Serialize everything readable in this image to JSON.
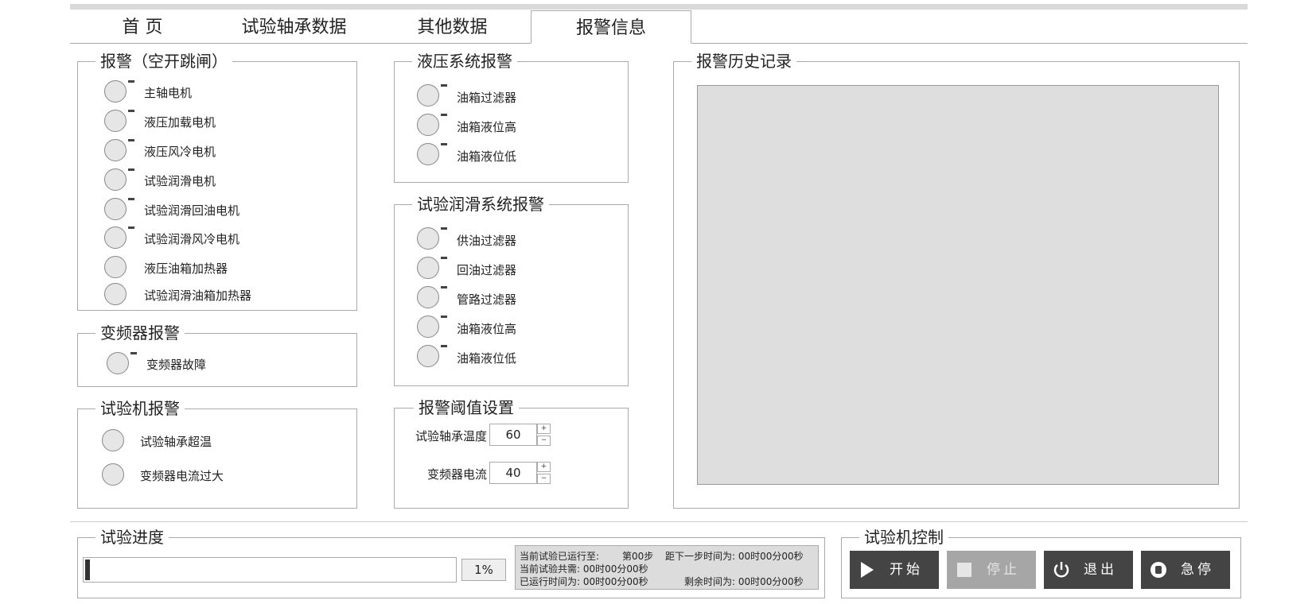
{
  "tabs": [
    "首  页",
    "试验轴承数据",
    "其他数据",
    "报警信息"
  ],
  "groups": {
    "breaker": {
      "title": "报警（空开跳闸）",
      "items": [
        "主轴电机",
        "液压加载电机",
        "液压风冷电机",
        "试验润滑电机",
        "试验润滑回油电机",
        "试验润滑风冷电机",
        "液压油箱加热器",
        "试验润滑油箱加热器"
      ]
    },
    "inverter": {
      "title": "变频器报警",
      "items": [
        "变频器故障"
      ]
    },
    "tester": {
      "title": "试验机报警",
      "items": [
        "试验轴承超温",
        "变频器电流过大"
      ]
    },
    "hydraulic": {
      "title": "液压系统报警",
      "items": [
        "油箱过滤器",
        "油箱液位高",
        "油箱液位低"
      ]
    },
    "lube": {
      "title": "试验润滑系统报警",
      "items": [
        "供油过滤器",
        "回油过滤器",
        "管路过滤器",
        "油箱液位高",
        "油箱液位低"
      ]
    },
    "threshold": {
      "title": "报警阈值设置",
      "bearing_temp_label": "试验轴承温度",
      "bearing_temp_value": "60",
      "inverter_current_label": "变频器电流",
      "inverter_current_value": "40",
      "plus": "+",
      "minus": "−"
    },
    "history": {
      "title": "报警历史记录"
    },
    "progress": {
      "title": "试验进度",
      "percent_value": 1,
      "percent_text": "1%",
      "line1a": "当前试验已运行至:",
      "line1b": "第00步",
      "line1c": "距下一步时间为: 00时00分00秒",
      "line2": "当前试验共需: 00时00分00秒",
      "line3a": "已运行时间为: 00时00分00秒",
      "line3b": "剩余时间为: 00时00分00秒"
    },
    "control": {
      "title": "试验机控制",
      "start": "开始",
      "stop": "停止",
      "exit": "退出",
      "estop": "急停"
    }
  },
  "colors": {
    "led": "#e6e6e6",
    "button_dark": "#444444",
    "button_disabled": "#a6a6a6",
    "history_bg": "#dedede"
  }
}
